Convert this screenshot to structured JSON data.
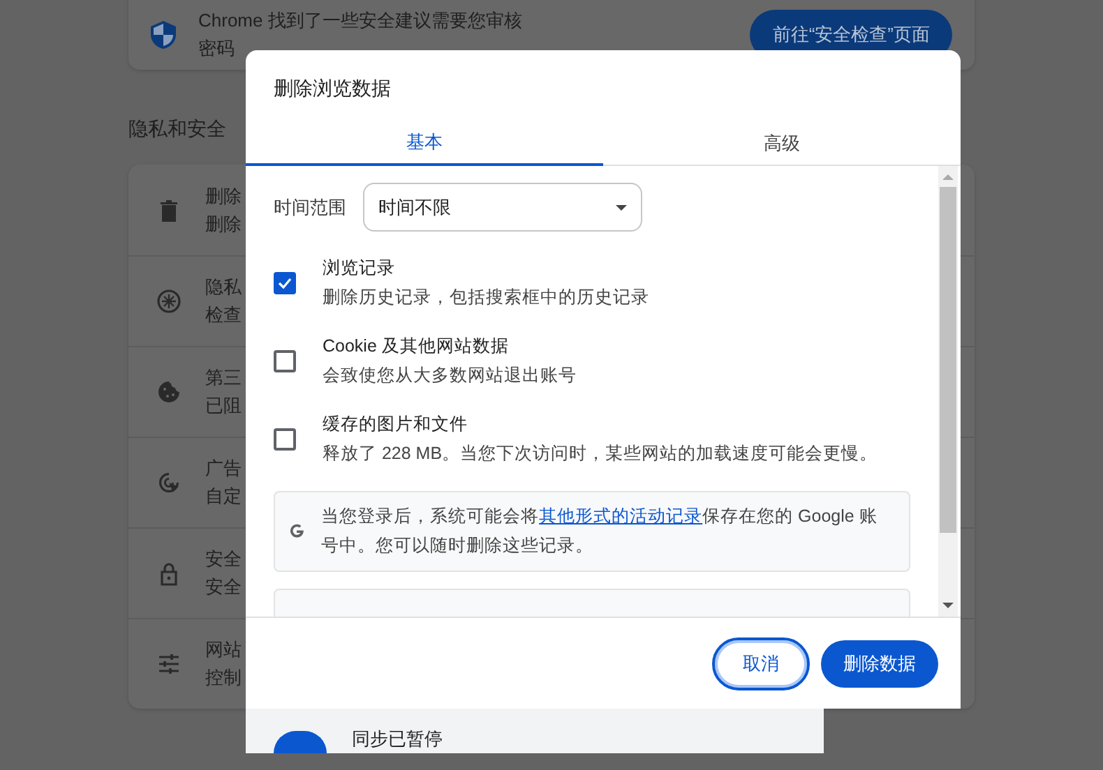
{
  "safety_card": {
    "message": "Chrome 找到了一些安全建议需要您审核",
    "detail": "密码",
    "button": "前往“安全检查”页面"
  },
  "section_title": "隐私和安全",
  "privacy_rows": [
    {
      "kind": "trash",
      "title": "删除",
      "subtitle": "删除"
    },
    {
      "kind": "aperture",
      "title": "隐私",
      "subtitle": "检查"
    },
    {
      "kind": "cookie",
      "title": "第三",
      "subtitle": "已阻"
    },
    {
      "kind": "target",
      "title": "广告",
      "subtitle": "自定"
    },
    {
      "kind": "lock",
      "title": "安全",
      "subtitle": "安全"
    },
    {
      "kind": "sliders",
      "title": "网站",
      "subtitle": "控制"
    }
  ],
  "dialog": {
    "title": "删除浏览数据",
    "tabs": [
      {
        "label": "基本",
        "selected": true
      },
      {
        "label": "高级",
        "selected": false
      }
    ],
    "time_range": {
      "label": "时间范围",
      "value": "时间不限"
    },
    "options": [
      {
        "title": "浏览记录",
        "description": "删除历史记录，包括搜索框中的历史记录",
        "checked": true
      },
      {
        "title": "Cookie 及其他网站数据",
        "description": "会致使您从大多数网站退出账号",
        "checked": false
      },
      {
        "title": "缓存的图片和文件",
        "description": "释放了 228 MB。当您下次访问时，某些网站的加载速度可能会更慢。",
        "checked": false
      }
    ],
    "google_notice": {
      "before": "当您登录后，系统可能会将",
      "link": "其他形式的活动记录",
      "after": "保存在您的 Google 账号中。您可以随时删除这些记录。"
    },
    "buttons": [
      {
        "kind": "secondary",
        "label": "取消"
      },
      {
        "kind": "primary",
        "label": "删除数据"
      }
    ]
  },
  "sync": {
    "status": "同步已暂停"
  }
}
